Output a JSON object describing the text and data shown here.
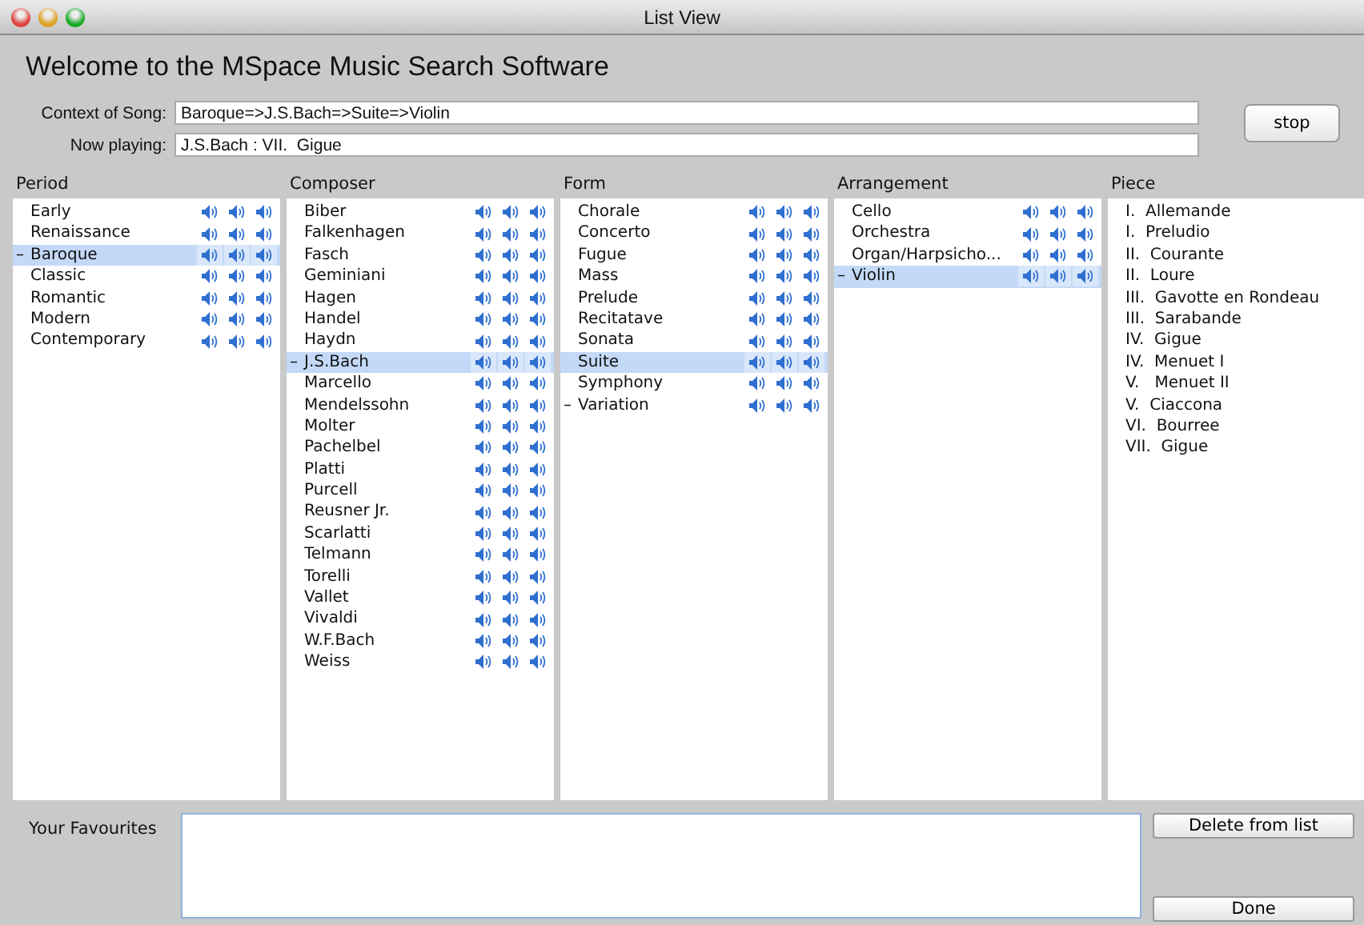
{
  "window": {
    "title": "List View"
  },
  "heading": "Welcome to the MSpace Music Search Software",
  "context": {
    "label": "Context of Song:",
    "value": "Baroque=>J.S.Bach=>Suite=>Violin"
  },
  "now_playing": {
    "label": "Now playing:",
    "value": "J.S.Bach : VII.  Gigue"
  },
  "stop_button": "stop",
  "columns": [
    {
      "title": "Period",
      "kind": "playable",
      "items": [
        {
          "label": "Early",
          "selected": false
        },
        {
          "label": "Renaissance",
          "selected": false
        },
        {
          "label": "Baroque",
          "prefix": "–",
          "selected": true
        },
        {
          "label": "Classic",
          "selected": false
        },
        {
          "label": "Romantic",
          "selected": false
        },
        {
          "label": "Modern",
          "selected": false
        },
        {
          "label": "Contemporary",
          "selected": false
        }
      ]
    },
    {
      "title": "Composer",
      "kind": "playable",
      "items": [
        {
          "label": "Biber",
          "selected": false
        },
        {
          "label": "Falkenhagen",
          "selected": false
        },
        {
          "label": "Fasch",
          "selected": false
        },
        {
          "label": "Geminiani",
          "selected": false
        },
        {
          "label": "Hagen",
          "selected": false
        },
        {
          "label": "Handel",
          "selected": false
        },
        {
          "label": "Haydn",
          "selected": false
        },
        {
          "label": "J.S.Bach",
          "prefix": "–",
          "selected": true
        },
        {
          "label": "Marcello",
          "selected": false
        },
        {
          "label": "Mendelssohn",
          "selected": false
        },
        {
          "label": "Molter",
          "selected": false
        },
        {
          "label": "Pachelbel",
          "selected": false
        },
        {
          "label": "Platti",
          "selected": false
        },
        {
          "label": "Purcell",
          "selected": false
        },
        {
          "label": "Reusner Jr.",
          "selected": false
        },
        {
          "label": "Scarlatti",
          "selected": false
        },
        {
          "label": "Telmann",
          "selected": false
        },
        {
          "label": "Torelli",
          "selected": false
        },
        {
          "label": "Vallet",
          "selected": false
        },
        {
          "label": "Vivaldi",
          "selected": false
        },
        {
          "label": "W.F.Bach",
          "selected": false
        },
        {
          "label": "Weiss",
          "selected": false
        }
      ]
    },
    {
      "title": "Form",
      "kind": "playable",
      "items": [
        {
          "label": "Chorale",
          "selected": false
        },
        {
          "label": "Concerto",
          "selected": false
        },
        {
          "label": "Fugue",
          "selected": false
        },
        {
          "label": "Mass",
          "selected": false
        },
        {
          "label": "Prelude",
          "selected": false
        },
        {
          "label": "Recitatave",
          "selected": false
        },
        {
          "label": "Sonata",
          "selected": false
        },
        {
          "label": "Suite",
          "selected": true
        },
        {
          "label": "Symphony",
          "selected": false
        },
        {
          "label": "Variation",
          "prefix": "–",
          "selected": false
        }
      ]
    },
    {
      "title": "Arrangement",
      "kind": "playable",
      "items": [
        {
          "label": "Cello",
          "selected": false
        },
        {
          "label": "Orchestra",
          "selected": false
        },
        {
          "label": "Organ/Harpsicho...",
          "selected": false
        },
        {
          "label": "Violin",
          "prefix": "–",
          "selected": true
        }
      ]
    },
    {
      "title": "Piece",
      "kind": "plain",
      "items": [
        {
          "label": "I.  Allemande",
          "selected": false
        },
        {
          "label": "I.  Preludio",
          "selected": false
        },
        {
          "label": "II.  Courante",
          "selected": false
        },
        {
          "label": "II.  Loure",
          "selected": false
        },
        {
          "label": "III.  Gavotte en Rondeau",
          "selected": false
        },
        {
          "label": "III.  Sarabande",
          "selected": false
        },
        {
          "label": "IV.  Gigue",
          "selected": false
        },
        {
          "label": "IV.  Menuet I",
          "selected": false
        },
        {
          "label": "V.   Menuet II",
          "selected": false
        },
        {
          "label": "V.  Ciaccona",
          "selected": false
        },
        {
          "label": "VI.  Bourree",
          "selected": false
        },
        {
          "label": "VII.  Gigue",
          "selected": false
        }
      ]
    }
  ],
  "favourites": {
    "label": "Your Favourites",
    "buttons": [
      "Delete from list",
      "Done"
    ]
  }
}
